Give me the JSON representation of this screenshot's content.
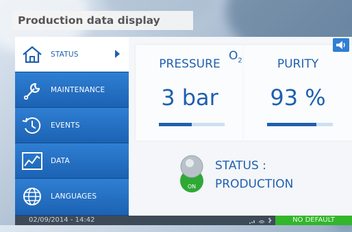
{
  "caption": "Production data display",
  "sidebar": {
    "items": [
      {
        "label": "STATUS",
        "icon": "home-icon",
        "active": true
      },
      {
        "label": "MAINTENANCE",
        "icon": "wrench-icon",
        "active": false
      },
      {
        "label": "EVENTS",
        "icon": "clock-history-icon",
        "active": false
      },
      {
        "label": "DATA",
        "icon": "chart-icon",
        "active": false
      },
      {
        "label": "LANGUAGES",
        "icon": "globe-icon",
        "active": false
      }
    ]
  },
  "pressure": {
    "title": "PRESSURE",
    "value": "3 bar",
    "level": 0.5
  },
  "purity": {
    "title_prefix": "O",
    "title_sub": "2",
    "title": "PURITY",
    "value": "93 %",
    "level": 0.75
  },
  "status": {
    "line1": "STATUS :",
    "line2": "PRODUCTION",
    "toggle_label": "ON"
  },
  "footer": {
    "datetime": "02/09/2014 - 14:42",
    "alarm": "NO DEFAULT"
  },
  "colors": {
    "accent": "#1f5fae",
    "nav": "#2f7fd3",
    "ok": "#33b52c"
  }
}
